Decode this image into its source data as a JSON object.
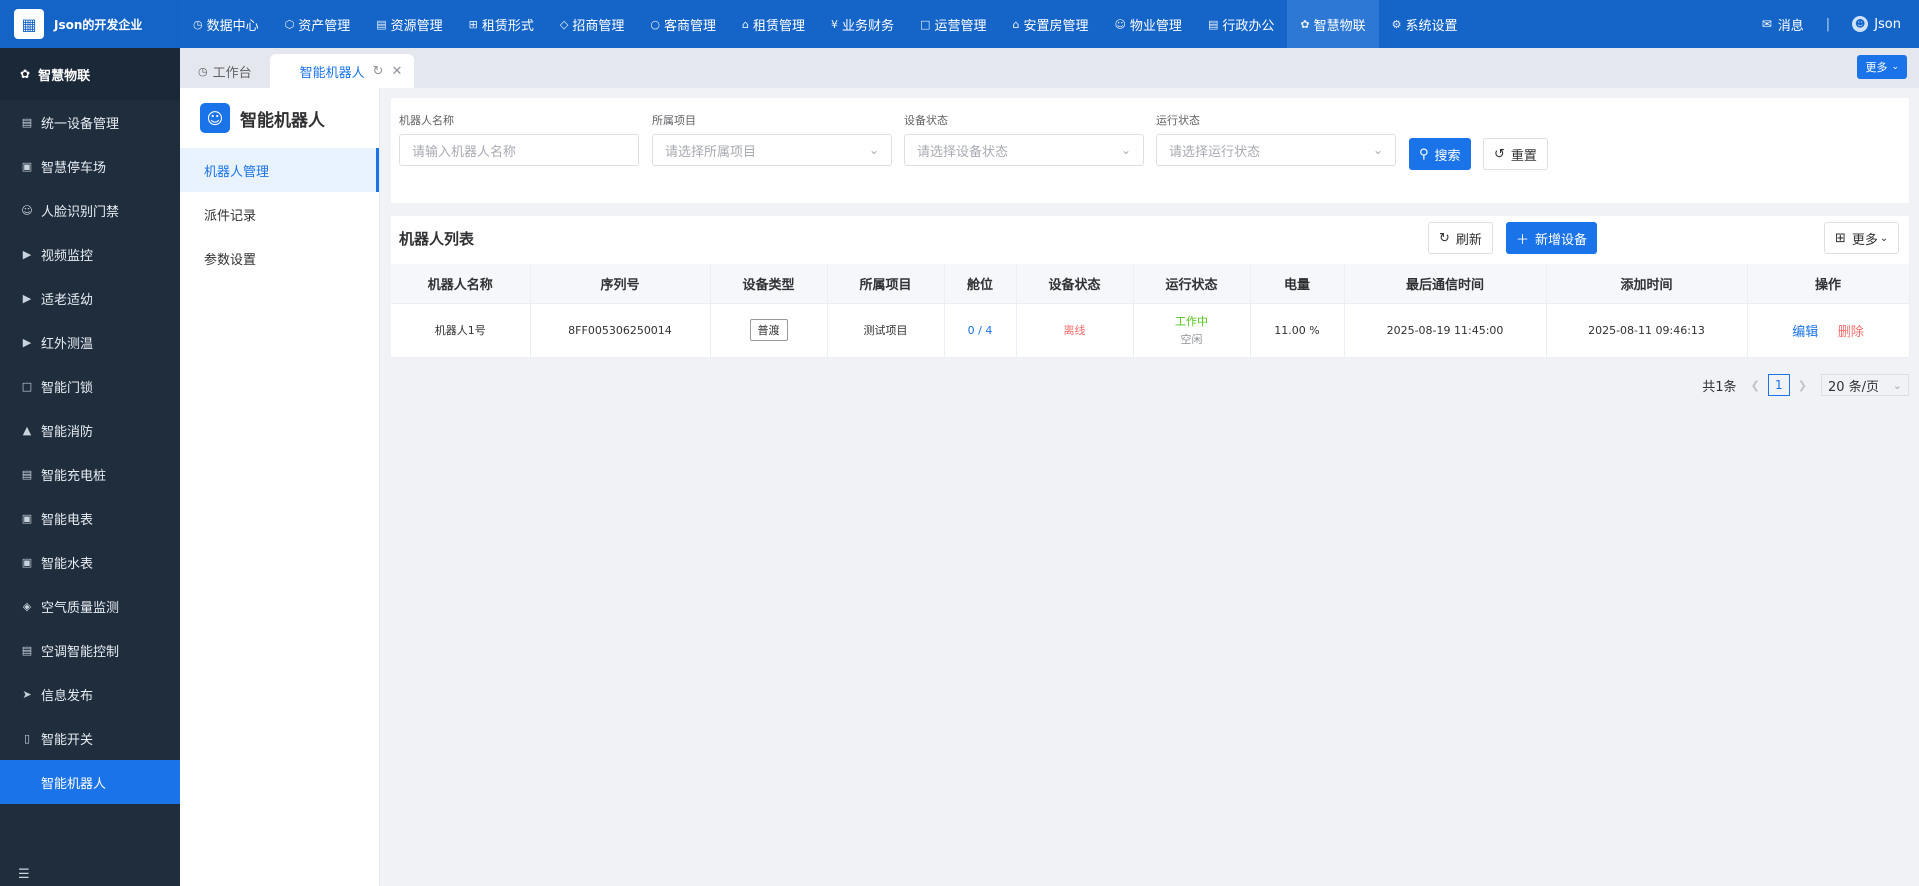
{
  "app": {
    "brand_name": "Json的开发企业",
    "brand_icon": "building-icon"
  },
  "topnav": {
    "items": [
      {
        "label": "数据中心",
        "icon": "clock-icon"
      },
      {
        "label": "资产管理",
        "icon": "cube-icon"
      },
      {
        "label": "资源管理",
        "icon": "document-icon"
      },
      {
        "label": "租赁形式",
        "icon": "grid-icon"
      },
      {
        "label": "招商管理",
        "icon": "tag-icon"
      },
      {
        "label": "客商管理",
        "icon": "group-icon"
      },
      {
        "label": "租赁管理",
        "icon": "home-icon"
      },
      {
        "label": "业务财务",
        "icon": "yen-icon"
      },
      {
        "label": "运营管理",
        "icon": "chart-icon"
      },
      {
        "label": "安置房管理",
        "icon": "house-icon"
      },
      {
        "label": "物业管理",
        "icon": "smile-icon"
      },
      {
        "label": "行政办公",
        "icon": "monitor-icon"
      },
      {
        "label": "智慧物联",
        "icon": "iot-icon"
      },
      {
        "label": "系统设置",
        "icon": "gear-icon"
      }
    ],
    "active_index": 12,
    "messages_label": "消息",
    "separator": "|",
    "user_name": "Json"
  },
  "sidebar": {
    "header": "智慧物联",
    "items": [
      {
        "label": "统一设备管理",
        "icon": "device-icon"
      },
      {
        "label": "智慧停车场",
        "icon": "parking-icon"
      },
      {
        "label": "人脸识别门禁",
        "icon": "face-icon"
      },
      {
        "label": "视频监控",
        "icon": "camera-icon"
      },
      {
        "label": "适老适幼",
        "icon": "camera-icon"
      },
      {
        "label": "红外测温",
        "icon": "camera-icon"
      },
      {
        "label": "智能门锁",
        "icon": "lock-icon"
      },
      {
        "label": "智能消防",
        "icon": "fire-icon"
      },
      {
        "label": "智能充电桩",
        "icon": "charger-icon"
      },
      {
        "label": "智能电表",
        "icon": "meter-icon"
      },
      {
        "label": "智能水表",
        "icon": "meter-icon"
      },
      {
        "label": "空气质量监测",
        "icon": "leaf-icon"
      },
      {
        "label": "空调智能控制",
        "icon": "ac-icon"
      },
      {
        "label": "信息发布",
        "icon": "send-icon"
      },
      {
        "label": "智能开关",
        "icon": "switch-icon"
      },
      {
        "label": "智能机器人",
        "icon": ""
      }
    ],
    "active_index": 15
  },
  "tabs": {
    "items": [
      {
        "label": "工作台",
        "icon": "dashboard-icon"
      },
      {
        "label": "智能机器人",
        "icon": ""
      }
    ],
    "active_index": 1,
    "more_label": "更多"
  },
  "submenu": {
    "title": "智能机器人",
    "items": [
      "机器人管理",
      "派件记录",
      "参数设置"
    ],
    "active_index": 0
  },
  "filters": {
    "name": {
      "label": "机器人名称",
      "placeholder": "请输入机器人名称"
    },
    "project": {
      "label": "所属项目",
      "placeholder": "请选择所属项目"
    },
    "device_status": {
      "label": "设备状态",
      "placeholder": "请选择设备状态"
    },
    "run_status": {
      "label": "运行状态",
      "placeholder": "请选择运行状态"
    },
    "search_label": "搜索",
    "reset_label": "重置"
  },
  "list": {
    "title": "机器人列表",
    "refresh_label": "刷新",
    "add_label": "新增设备",
    "more_label": "更多",
    "columns": [
      "机器人名称",
      "序列号",
      "设备类型",
      "所属项目",
      "舱位",
      "设备状态",
      "运行状态",
      "电量",
      "最后通信时间",
      "添加时间",
      "操作"
    ],
    "rows": [
      {
        "name": "机器人1号",
        "serial": "8FF005306250014",
        "type": "普渡",
        "project": "测试项目",
        "slot": "0 / 4",
        "device_status": "离线",
        "run_status": "工作中",
        "run_sub_status": "空闲",
        "battery": "11.00 %",
        "last_comm": "2025-08-19 11:45:00",
        "added": "2025-08-11 09:46:13",
        "edit_label": "编辑",
        "delete_label": "删除"
      }
    ]
  },
  "pager": {
    "total_label": "共1条",
    "current_page": "1",
    "page_size_label": "20 条/页"
  },
  "colors": {
    "topbar": "#1565c9",
    "sidebar": "#1f2d3d",
    "accent": "#1a73e8",
    "danger": "#f56c6c",
    "success": "#52c41a"
  }
}
